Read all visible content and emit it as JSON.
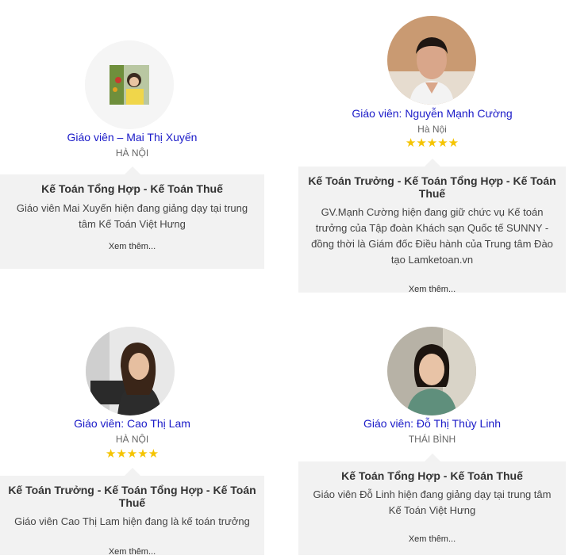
{
  "teachers": [
    {
      "name": "Giáo viên – Mai Thị Xuyến",
      "city": "HÀ NỘI",
      "subject": "Kế Toán Tổng Hợp - Kế Toán Thuế",
      "description": "Giáo viên Mai Xuyến hiện đang giảng dạy tại trung tâm Kế Toán Việt Hưng",
      "more": "Xem thêm..."
    },
    {
      "name": "Giáo viên: Nguyễn Mạnh Cường",
      "city": "Hà Nội",
      "stars": "★★★★★",
      "rating": 5,
      "subject": "Kế Toán Trưởng - Kế Toán Tổng Hợp - Kế Toán Thuế",
      "description": "GV.Mạnh Cường hiện đang giữ chức vụ Kế toán trưởng của Tập đoàn Khách sạn Quốc tế SUNNY - đồng thời là Giám đốc Điều hành của Trung tâm Đào tạo Lamketoan.vn",
      "more": "Xem thêm..."
    },
    {
      "name": "Giáo viên: Cao Thị Lam",
      "city": "HÀ NỘI",
      "stars": "★★★★★",
      "rating": 5,
      "subject": "Kế Toán Trưởng - Kế Toán Tổng Hợp - Kế Toán Thuế",
      "description": "Giáo viên Cao Thị Lam hiện đang là kế toán trưởng",
      "more": "Xem thêm..."
    },
    {
      "name": "Giáo viên: Đỗ Thị Thùy Linh",
      "city": "THÁI BÌNH",
      "subject": "Kế Toán Tổng Hợp - Kế Toán Thuế",
      "description": "Giáo viên Đỗ Linh hiện đang giảng dạy tại trung tâm Kế Toán Việt Hưng",
      "more": "Xem thêm..."
    }
  ],
  "colors": {
    "name": "#1a1ac8",
    "star": "#f5c400",
    "box": "#f2f2f2"
  }
}
